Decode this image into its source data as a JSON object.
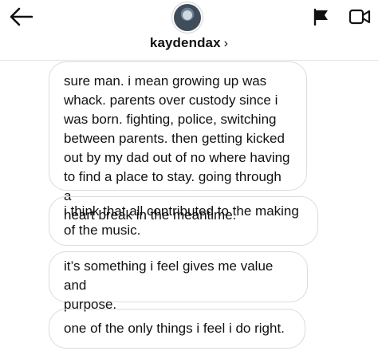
{
  "header": {
    "username": "kaydendax",
    "chevron": "›",
    "icons": [
      "back-arrow-icon",
      "flag-icon",
      "video-call-icon"
    ]
  },
  "messages": [
    "sure man. i mean growing up was\nwhack. parents over custody since i\nwas born. fighting, police, switching\nbetween parents. then getting kicked\nout by my dad out of no where having\nto find a place to stay. going through a\nheart break in the meantime.",
    "i think that all contributed to the making\nof the music.",
    "it’s something i feel gives me value and\npurpose.",
    "one of the only things i feel i do right."
  ]
}
